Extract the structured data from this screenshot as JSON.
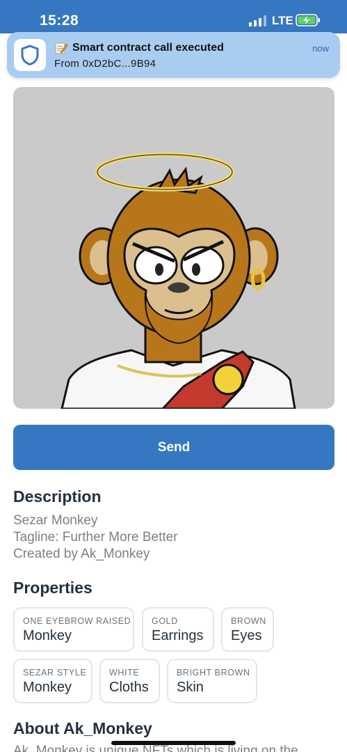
{
  "status_bar": {
    "time": "15:28",
    "network": "LTE"
  },
  "notification": {
    "icon": "shield-icon",
    "title": "Smart contract call executed",
    "body": "From 0xD2bC...9B94",
    "time": "now"
  },
  "nft": {
    "image": "nft-monkey-image"
  },
  "actions": {
    "send_label": "Send"
  },
  "description": {
    "heading": "Description",
    "lines": [
      "Sezar Monkey",
      "Tagline: Further More Better",
      "Created by Ak_Monkey"
    ]
  },
  "properties": {
    "heading": "Properties",
    "items": [
      {
        "key": "ONE EYEBROW RAISED",
        "value": "Monkey"
      },
      {
        "key": "GOLD",
        "value": "Earrings"
      },
      {
        "key": "BROWN",
        "value": "Eyes"
      },
      {
        "key": "SEZAR STYLE",
        "value": "Monkey"
      },
      {
        "key": "WHITE",
        "value": "Cloths"
      },
      {
        "key": "BRIGHT BROWN",
        "value": "Skin"
      }
    ]
  },
  "about": {
    "heading": "About Ak_Monkey",
    "text": "Ak_Monkey is unique NFTs which is living on the"
  },
  "colors": {
    "accent": "#3677c1",
    "notification_bg": "#a9cdf1",
    "card_bg": "#cacaca"
  }
}
